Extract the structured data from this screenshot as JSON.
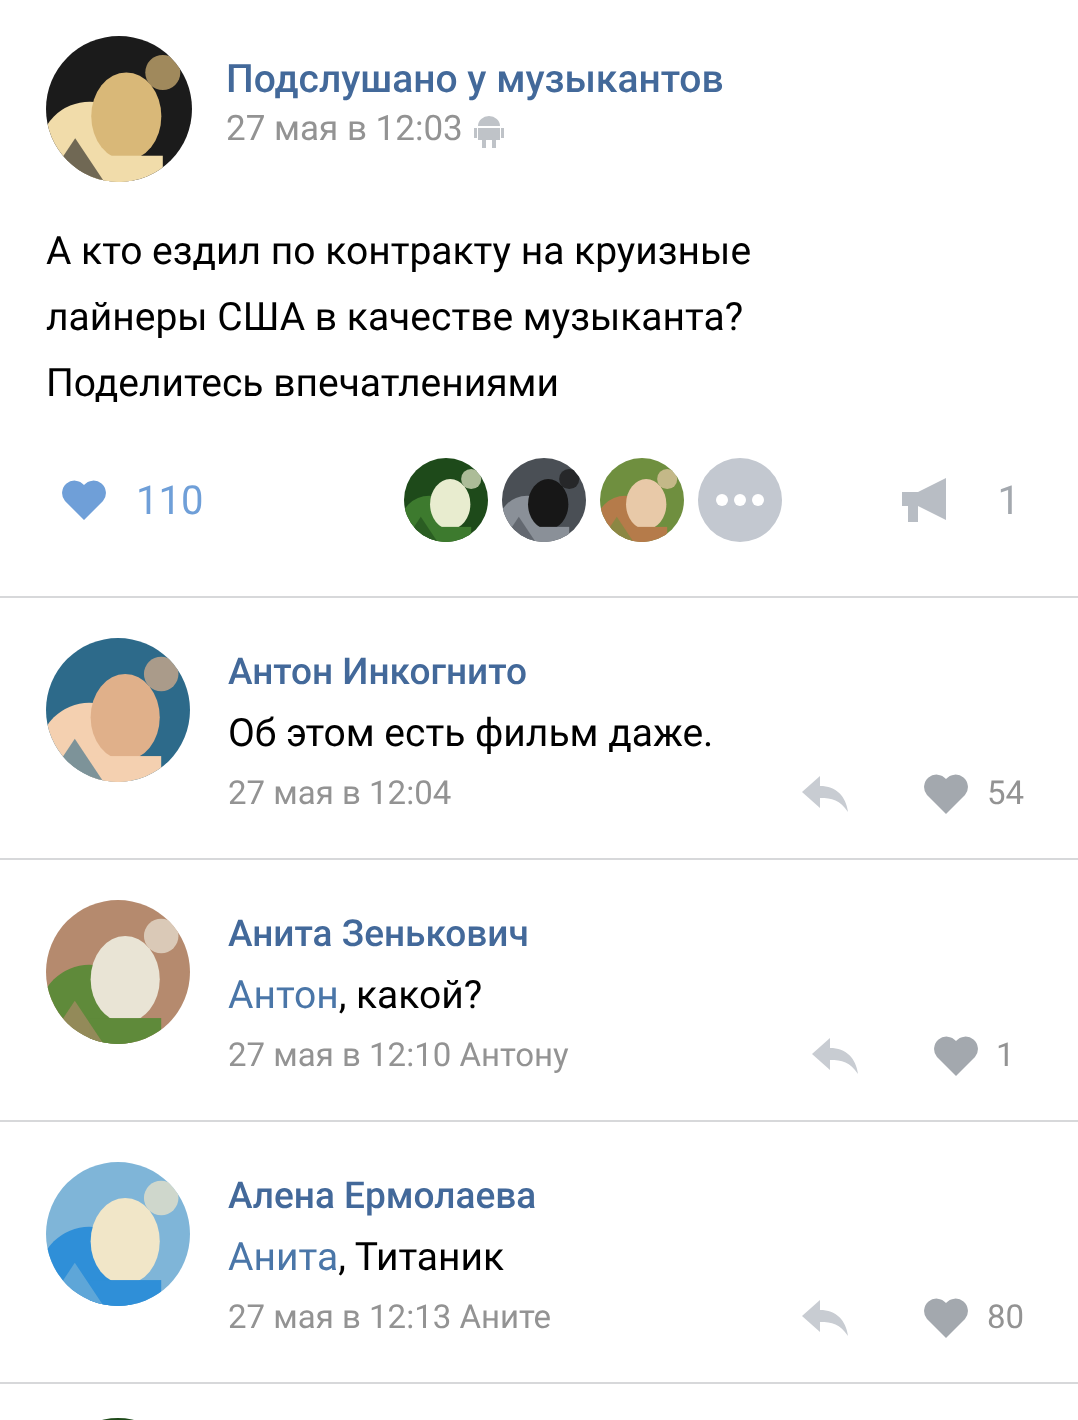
{
  "post": {
    "author": "Подслушано у музыкантов",
    "date": "27 мая в 12:03",
    "text": "А кто ездил по контракту на круизные лайнеры США в качестве музыканта? Поделитесь впечатлениями",
    "likes": {
      "count": "110",
      "liked": true
    },
    "reposts": "1"
  },
  "comments": [
    {
      "author": "Антон Инкогнито",
      "text": "Об этом есть фильм даже.",
      "date": "27 мая в 12:04",
      "likes": "54",
      "liked": false
    },
    {
      "author": "Анита Зенькович",
      "reply_to": "Антон",
      "text": ", какой?",
      "date": "27 мая в 12:10 Антону",
      "likes": "1",
      "liked": false
    },
    {
      "author": "Алена Ермолаева",
      "reply_to": "Анита",
      "text": ", Титаник",
      "date": "27 мая в 12:13 Аните",
      "likes": "80",
      "liked": false
    }
  ]
}
